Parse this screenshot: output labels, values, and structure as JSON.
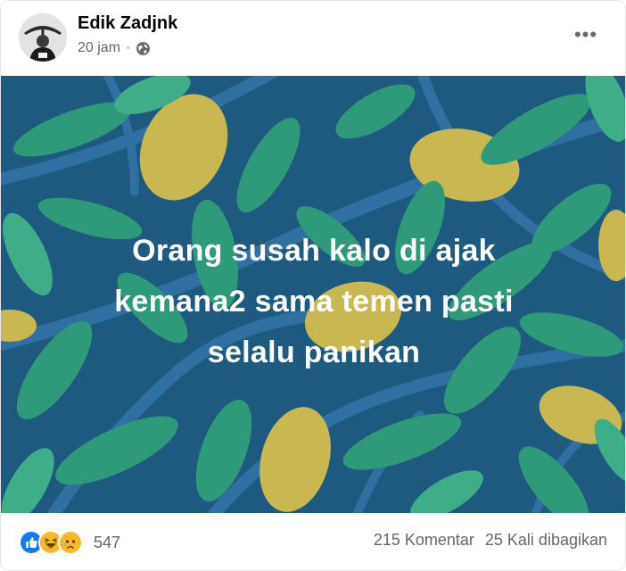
{
  "post": {
    "author": "Edik Zadjnk",
    "time": "20 jam",
    "separator": "·",
    "privacy_icon": "globe-icon",
    "more_label": "•••",
    "caption_line1": "Orang susah kalo di ajak",
    "caption_line2": "kemana2 sama temen pasti",
    "caption_line3": "selalu panikan",
    "background_colors": {
      "base": "#1e5a7f",
      "branch": "#2f6fa1",
      "leaf": "#2f9a79",
      "leaf_light": "#3fae88",
      "lemon": "#c9b851"
    }
  },
  "footer": {
    "reaction_icons": [
      "like-icon",
      "haha-icon",
      "sad-icon"
    ],
    "reaction_count": "547",
    "comments": "215 Komentar",
    "shares": "25 Kali dibagikan"
  }
}
